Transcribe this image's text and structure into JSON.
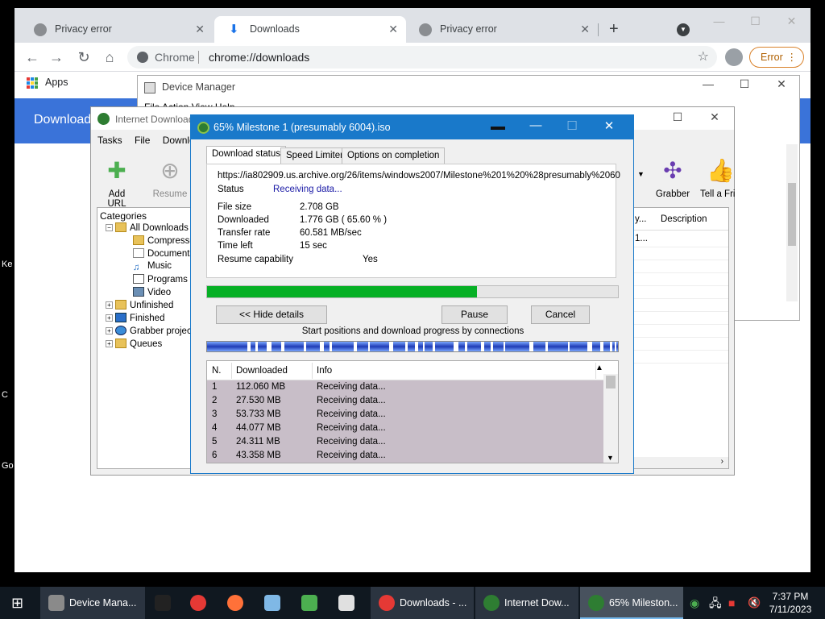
{
  "desktop": {
    "edge_texts": [
      "Ke",
      "C",
      "Go"
    ]
  },
  "chrome": {
    "tabs": [
      {
        "label": "Privacy error",
        "active": false
      },
      {
        "label": "Downloads",
        "active": true
      },
      {
        "label": "Privacy error",
        "active": false
      }
    ],
    "new_tab": "+",
    "address_scheme": "Chrome",
    "address_url": "chrome://downloads",
    "error_button": "Error",
    "bookmarks_apps": "Apps",
    "page_header": "Downloads"
  },
  "device_manager": {
    "title": "Device Manager",
    "menu": "File   Action   View   Help"
  },
  "idm": {
    "title": "Internet Download Manager",
    "menu": [
      "Tasks",
      "File",
      "Downloads"
    ],
    "toolbar": {
      "add_url": "Add URL",
      "resume": "Resume",
      "grabber": "Grabber",
      "tell_friend": "Tell a Fri"
    },
    "categories_label": "Categories",
    "categories": [
      {
        "label": "All Downloads",
        "level": 0
      },
      {
        "label": "Compressed",
        "level": 1
      },
      {
        "label": "Documents",
        "level": 1
      },
      {
        "label": "Music",
        "level": 1
      },
      {
        "label": "Programs",
        "level": 1
      },
      {
        "label": "Video",
        "level": 1
      },
      {
        "label": "Unfinished",
        "level": 0
      },
      {
        "label": "Finished",
        "level": 0
      },
      {
        "label": "Grabber projects",
        "level": 0
      },
      {
        "label": "Queues",
        "level": 0
      }
    ],
    "list_columns": {
      "partial": "y...",
      "description": "Description"
    },
    "list_partial_cell": "1..."
  },
  "progress_dialog": {
    "title": "65% Milestone 1 (presumably 6004).iso",
    "tabs": [
      "Download status",
      "Speed Limiter",
      "Options on completion"
    ],
    "url": "https://ia802909.us.archive.org/26/items/windows2007/Milestone%201%20%28presumably%2060",
    "status_label": "Status",
    "status_value": "Receiving data...",
    "file_size_label": "File size",
    "file_size_value": "2.708  GB",
    "downloaded_label": "Downloaded",
    "downloaded_value": "1.776  GB  ( 65.60 % )",
    "transfer_rate_label": "Transfer rate",
    "transfer_rate_value": "60.581  MB/sec",
    "time_left_label": "Time left",
    "time_left_value": "15 sec",
    "resume_label": "Resume capability",
    "resume_value": "Yes",
    "progress_percent": 65.6,
    "hide_details": "<< Hide details",
    "pause": "Pause",
    "cancel": "Cancel",
    "connections_label": "Start positions and download progress by connections",
    "table_headers": [
      "N.",
      "Downloaded",
      "Info"
    ],
    "connections": [
      {
        "n": "1",
        "downloaded": "112.060  MB",
        "info": "Receiving data..."
      },
      {
        "n": "2",
        "downloaded": "27.530  MB",
        "info": "Receiving data..."
      },
      {
        "n": "3",
        "downloaded": "53.733  MB",
        "info": "Receiving data..."
      },
      {
        "n": "4",
        "downloaded": "44.077  MB",
        "info": "Receiving data..."
      },
      {
        "n": "5",
        "downloaded": "24.311  MB",
        "info": "Receiving data..."
      },
      {
        "n": "6",
        "downloaded": "43.358  MB",
        "info": "Receiving data..."
      }
    ]
  },
  "taskbar": {
    "items": [
      {
        "label": "Device Mana...",
        "icon": "device-manager-icon",
        "color": "#8a8a8a"
      },
      {
        "label": "",
        "icon": "terminal-icon",
        "color": "#222222"
      },
      {
        "label": "",
        "icon": "chrome-icon",
        "color": "#e53935"
      },
      {
        "label": "",
        "icon": "firefox-icon",
        "color": "#ff7139"
      },
      {
        "label": "",
        "icon": "notepad-icon",
        "color": "#7fb8e6"
      },
      {
        "label": "",
        "icon": "taskmgr-icon",
        "color": "#4caf50"
      },
      {
        "label": "",
        "icon": "paint-icon",
        "color": "#e0e0e0"
      },
      {
        "label": "Downloads - ...",
        "icon": "chrome-icon",
        "color": "#e53935"
      },
      {
        "label": "Internet Dow...",
        "icon": "idm-icon",
        "color": "#2e7d32"
      },
      {
        "label": "65% Mileston...",
        "icon": "idm-icon",
        "color": "#2e7d32"
      }
    ],
    "time": "7:37 PM",
    "date": "7/11/2023"
  }
}
